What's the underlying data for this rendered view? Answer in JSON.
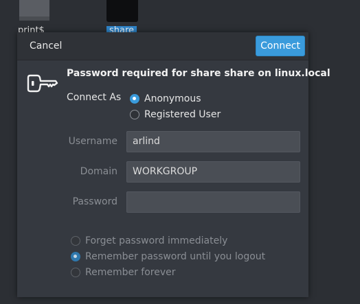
{
  "desktop": {
    "icons": [
      {
        "label": "print$"
      },
      {
        "label": "share"
      }
    ]
  },
  "dialog": {
    "cancel_label": "Cancel",
    "connect_label": "Connect",
    "title": "Password required for share share on linux.local",
    "connect_as_label": "Connect As",
    "connect_as_options": [
      {
        "label": "Anonymous",
        "selected": true
      },
      {
        "label": "Registered User",
        "selected": false
      }
    ],
    "fields": {
      "username": {
        "label": "Username",
        "value": "arlind"
      },
      "domain": {
        "label": "Domain",
        "value": "WORKGROUP"
      },
      "password": {
        "label": "Password",
        "value": ""
      }
    },
    "remember_options": [
      {
        "label": "Forget password immediately",
        "selected": false
      },
      {
        "label": "Remember password until you logout",
        "selected": true
      },
      {
        "label": "Remember forever",
        "selected": false
      }
    ]
  },
  "colors": {
    "accent": "#3a9bdc",
    "dialog_bg": "#353940",
    "field_bg": "#4a4e55"
  },
  "icons": {
    "dialog_icon": "key-icon"
  }
}
